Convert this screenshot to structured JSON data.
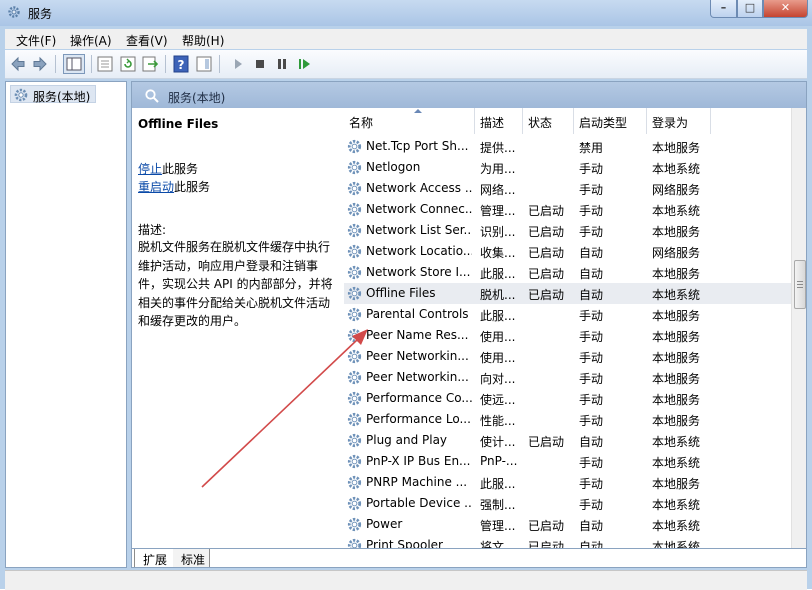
{
  "window": {
    "title": "服务"
  },
  "menu": [
    "文件(F)",
    "操作(A)",
    "查看(V)",
    "帮助(H)"
  ],
  "tree": {
    "root_label": "服务(本地)"
  },
  "pane": {
    "header_label": "服务(本地)"
  },
  "description": {
    "service_title": "Offline Files",
    "stop_link": "停止",
    "stop_suffix": "此服务",
    "restart_link": "重启动",
    "restart_suffix": "此服务",
    "label": "描述:",
    "text": "脱机文件服务在脱机文件缓存中执行维护活动，响应用户登录和注销事件，实现公共 API 的内部部分，并将相关的事件分配给关心脱机文件活动和缓存更改的用户。"
  },
  "columns": {
    "name": "名称",
    "desc": "描述",
    "status": "状态",
    "start": "启动类型",
    "logon": "登录为"
  },
  "services": [
    {
      "name": "Net.Tcp Port Sh...",
      "desc": "提供...",
      "status": "",
      "start": "禁用",
      "logon": "本地服务"
    },
    {
      "name": "Netlogon",
      "desc": "为用...",
      "status": "",
      "start": "手动",
      "logon": "本地系统"
    },
    {
      "name": "Network Access ...",
      "desc": "网络...",
      "status": "",
      "start": "手动",
      "logon": "网络服务"
    },
    {
      "name": "Network Connec...",
      "desc": "管理...",
      "status": "已启动",
      "start": "手动",
      "logon": "本地系统"
    },
    {
      "name": "Network List Ser...",
      "desc": "识别...",
      "status": "已启动",
      "start": "手动",
      "logon": "本地服务"
    },
    {
      "name": "Network Locatio...",
      "desc": "收集...",
      "status": "已启动",
      "start": "自动",
      "logon": "网络服务"
    },
    {
      "name": "Network Store I...",
      "desc": "此服...",
      "status": "已启动",
      "start": "自动",
      "logon": "本地服务"
    },
    {
      "name": "Offline Files",
      "desc": "脱机...",
      "status": "已启动",
      "start": "自动",
      "logon": "本地系统"
    },
    {
      "name": "Parental Controls",
      "desc": "此服...",
      "status": "",
      "start": "手动",
      "logon": "本地服务"
    },
    {
      "name": "Peer Name Res...",
      "desc": "使用...",
      "status": "",
      "start": "手动",
      "logon": "本地服务"
    },
    {
      "name": "Peer Networkin...",
      "desc": "使用...",
      "status": "",
      "start": "手动",
      "logon": "本地服务"
    },
    {
      "name": "Peer Networkin...",
      "desc": "向对...",
      "status": "",
      "start": "手动",
      "logon": "本地服务"
    },
    {
      "name": "Performance Co...",
      "desc": "使远...",
      "status": "",
      "start": "手动",
      "logon": "本地服务"
    },
    {
      "name": "Performance Lo...",
      "desc": "性能...",
      "status": "",
      "start": "手动",
      "logon": "本地服务"
    },
    {
      "name": "Plug and Play",
      "desc": "使计...",
      "status": "已启动",
      "start": "自动",
      "logon": "本地系统"
    },
    {
      "name": "PnP-X IP Bus En...",
      "desc": "PnP-...",
      "status": "",
      "start": "手动",
      "logon": "本地系统"
    },
    {
      "name": "PNRP Machine ...",
      "desc": "此服...",
      "status": "",
      "start": "手动",
      "logon": "本地服务"
    },
    {
      "name": "Portable Device ...",
      "desc": "强制...",
      "status": "",
      "start": "手动",
      "logon": "本地系统"
    },
    {
      "name": "Power",
      "desc": "管理...",
      "status": "已启动",
      "start": "自动",
      "logon": "本地系统"
    },
    {
      "name": "Print Spooler",
      "desc": "将文...",
      "status": "已启动",
      "start": "自动",
      "logon": "本地系统"
    }
  ],
  "tabs": [
    "扩展",
    "标准"
  ],
  "colors": {
    "title_bg": "#b9d1ea",
    "pane_header": "#a9c0de",
    "link": "#0b4aa8",
    "annotation_arrow": "#d24a4a",
    "gear": "#5a86b8"
  }
}
